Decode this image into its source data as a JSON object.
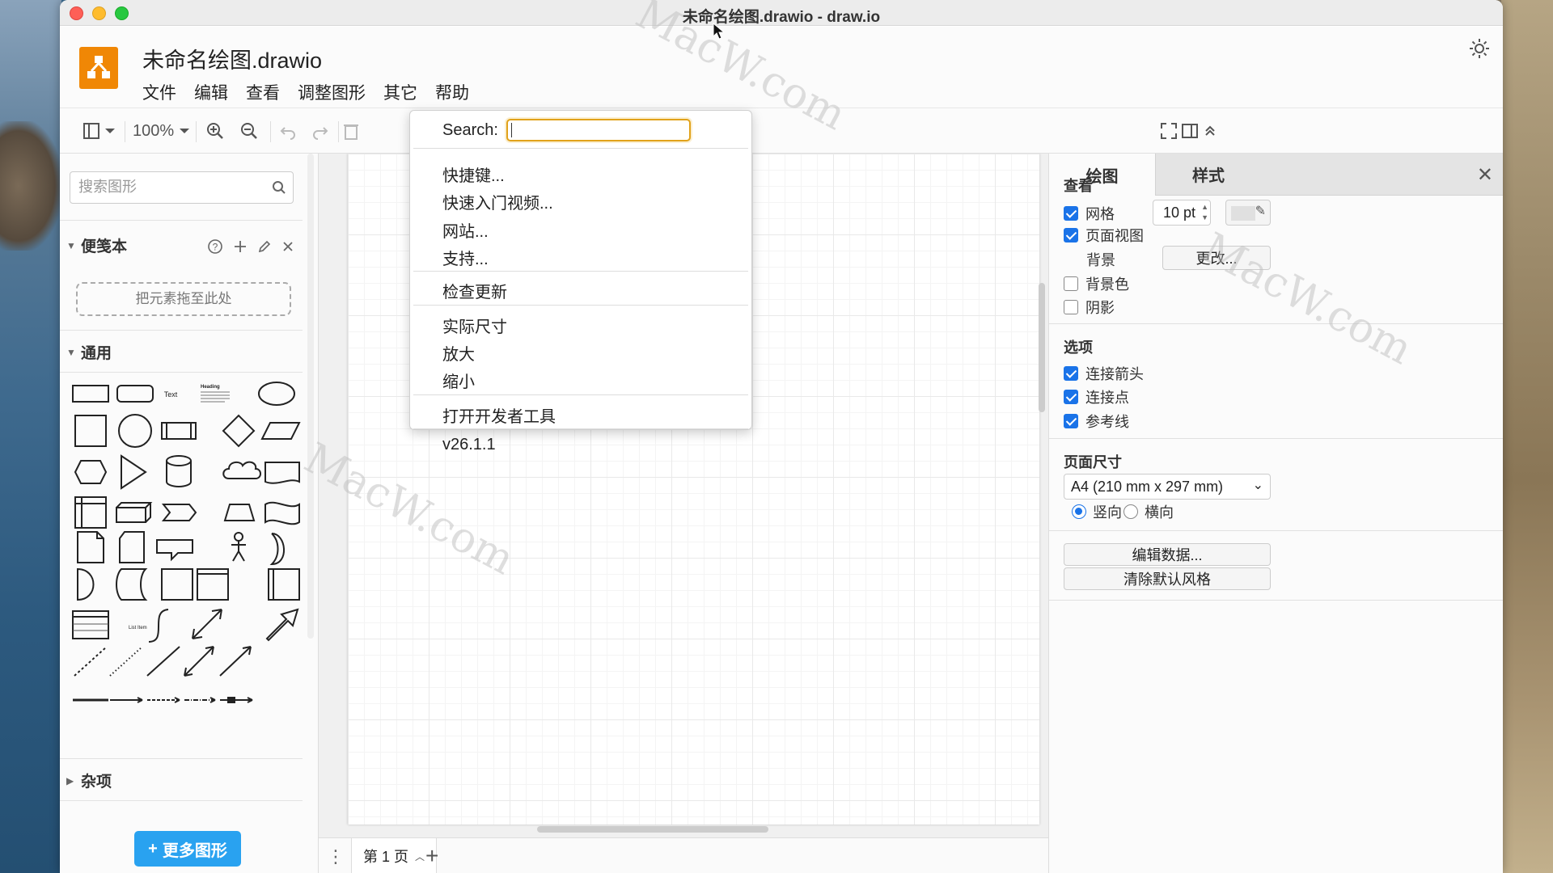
{
  "window": {
    "title": "未命名绘图.drawio - draw.io"
  },
  "header": {
    "filename": "未命名绘图.drawio",
    "menus": [
      "文件",
      "编辑",
      "查看",
      "调整图形",
      "其它",
      "帮助"
    ]
  },
  "toolbar": {
    "zoom": "100%"
  },
  "help_menu": {
    "search_label": "Search:",
    "search_value": "",
    "items": [
      "快捷键...",
      "快速入门视频...",
      "网站...",
      "支持...",
      "检查更新",
      "实际尺寸",
      "放大",
      "缩小",
      "打开开发者工具",
      "v26.1.1"
    ]
  },
  "sidebar": {
    "search_placeholder": "搜索图形",
    "scratchpad_title": "便笺本",
    "drop_hint": "把元素拖至此处",
    "general_title": "通用",
    "misc_title": "杂项",
    "shape_text_label": "Text",
    "shape_heading_label": "Heading",
    "shape_list_item_label": "List Item",
    "more_shapes": "更多图形"
  },
  "right_panel": {
    "tab_diagram": "绘图",
    "tab_style": "样式",
    "view_title": "查看",
    "grid_label": "网格",
    "grid_size": "10 pt",
    "page_view_label": "页面视图",
    "background_label": "背景",
    "change_button": "更改...",
    "bg_color_label": "背景色",
    "shadow_label": "阴影",
    "options_title": "选项",
    "connection_arrows": "连接箭头",
    "connection_points": "连接点",
    "guides": "参考线",
    "page_size_title": "页面尺寸",
    "page_size_value": "A4 (210 mm x 297 mm)",
    "portrait": "竖向",
    "landscape": "横向",
    "edit_data_button": "编辑数据...",
    "clear_style_button": "清除默认风格"
  },
  "pagebar": {
    "page_tab": "第 1 页"
  },
  "watermark": "MacW.com",
  "colors": {
    "accent": "#29a2f0",
    "logo": "#f08705",
    "check": "#1a73e8",
    "search_focus": "#e1a21a"
  }
}
